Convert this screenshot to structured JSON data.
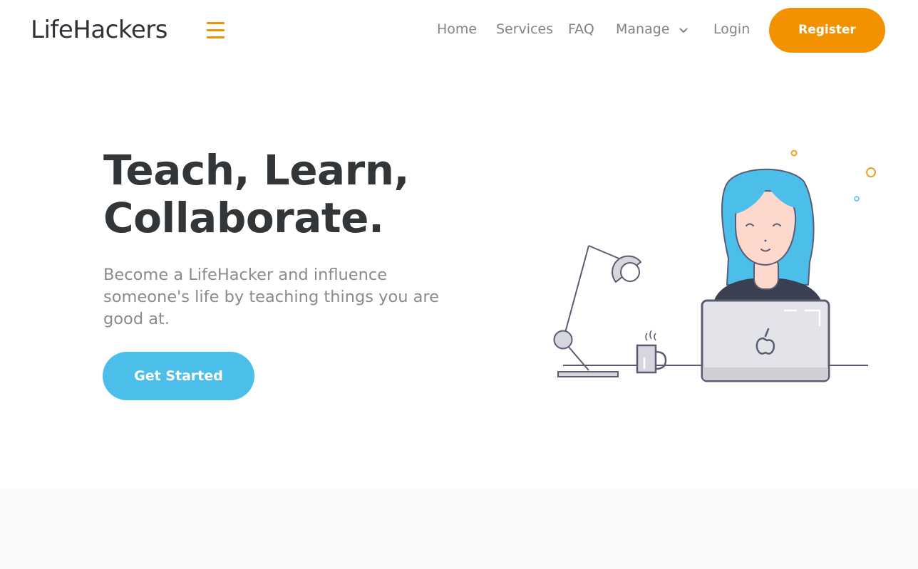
{
  "navbar": {
    "brand": "LifeHackers",
    "menu_icon": "hamburger-icon",
    "links": [
      {
        "label": "Home"
      },
      {
        "label": "Services"
      },
      {
        "label": "FAQ"
      },
      {
        "label": "Manage",
        "icon": "chevron-down-icon"
      },
      {
        "label": "Login"
      }
    ],
    "register_label": "Register"
  },
  "hero": {
    "title_line1": "Teach, Learn,",
    "title_line2": "Collaborate.",
    "subtitle": "Become a LifeHacker and influence someone's life by teaching things you are good at.",
    "cta_label": "Get Started"
  },
  "illustration": {
    "icon": "woman-at-laptop-illustration"
  },
  "colors": {
    "accent_orange": "#f39200",
    "accent_blue": "#4bbfea",
    "heading": "#333638",
    "muted_text": "#8b8b8b",
    "nav_text": "#838383"
  }
}
